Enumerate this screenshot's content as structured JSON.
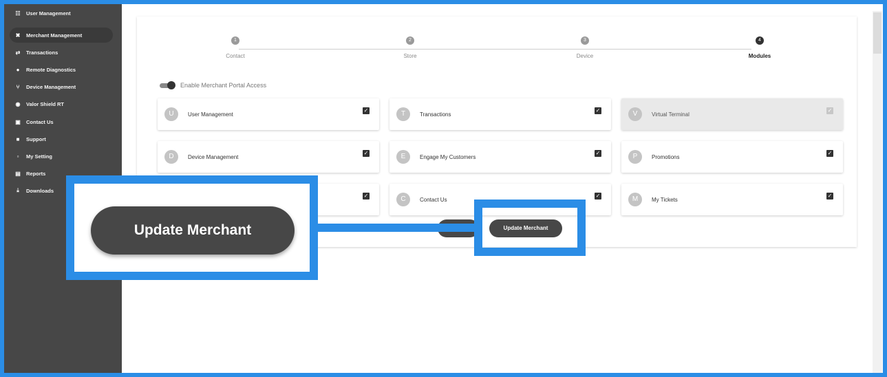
{
  "sidebar": {
    "items": [
      {
        "label": "User Management",
        "icon": "users-icon",
        "glyph": "☷"
      },
      {
        "label": "Merchant Management",
        "icon": "cart-icon",
        "glyph": "✖",
        "active": true
      },
      {
        "label": "Transactions",
        "icon": "arrows-icon",
        "glyph": "⇄"
      },
      {
        "label": "Remote Diagnostics",
        "icon": "dot-icon",
        "glyph": "●"
      },
      {
        "label": "Device Management",
        "icon": "device-icon",
        "glyph": "⑂"
      },
      {
        "label": "Valor Shield RT",
        "icon": "shield-icon",
        "glyph": "◉"
      },
      {
        "label": "Contact Us",
        "icon": "contact-icon",
        "glyph": "▣"
      },
      {
        "label": "Support",
        "icon": "support-icon",
        "glyph": "■"
      },
      {
        "label": "My Setting",
        "icon": "settings-icon",
        "glyph": "▫"
      },
      {
        "label": "Reports",
        "icon": "report-icon",
        "glyph": "▤"
      },
      {
        "label": "Downloads",
        "icon": "download-icon",
        "glyph": "⤓"
      }
    ]
  },
  "stepper": {
    "steps": [
      {
        "num": "1",
        "label": "Contact"
      },
      {
        "num": "2",
        "label": "Store"
      },
      {
        "num": "3",
        "label": "Device"
      },
      {
        "num": "4",
        "label": "Modules",
        "active": true
      }
    ]
  },
  "portal_toggle": {
    "label": "Enable Merchant Portal Access",
    "on": true
  },
  "modules": [
    {
      "letter": "U",
      "name": "User Management",
      "checked": true
    },
    {
      "letter": "T",
      "name": "Transactions",
      "checked": true
    },
    {
      "letter": "V",
      "name": "Virtual Terminal",
      "checked": true,
      "disabled": true
    },
    {
      "letter": "D",
      "name": "Device Management",
      "checked": true
    },
    {
      "letter": "E",
      "name": "Engage My Customers",
      "checked": true
    },
    {
      "letter": "P",
      "name": "Promotions",
      "checked": true
    },
    {
      "letter": "",
      "name": "",
      "checked": true
    },
    {
      "letter": "C",
      "name": "Contact Us",
      "checked": true
    },
    {
      "letter": "M",
      "name": "My Tickets",
      "checked": true
    }
  ],
  "actions": {
    "update_label": "Update Merchant",
    "callout_label": "Update Merchant"
  },
  "colors": {
    "accent": "#2b8de6",
    "sidebar": "#474747",
    "button": "#474747"
  }
}
